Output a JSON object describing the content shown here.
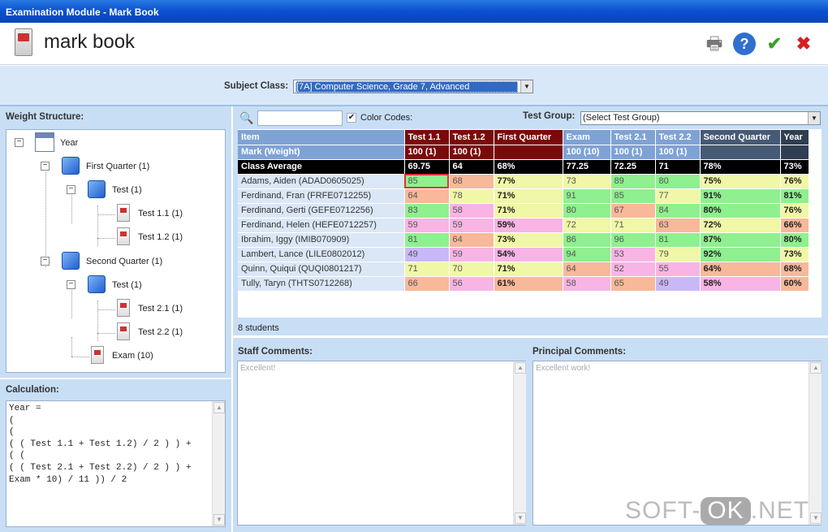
{
  "window": {
    "title": "Examination Module - Mark Book"
  },
  "header": {
    "title": "mark book"
  },
  "subject": {
    "label": "Subject Class:",
    "value": "[7A] Computer Science, Grade 7, Advanced"
  },
  "weight": {
    "heading": "Weight Structure:",
    "nodes": [
      "Year",
      "First Quarter (1)",
      "Test (1)",
      "Test 1.1 (1)",
      "Test 1.2 (1)",
      "Second Quarter (1)",
      "Test (1)",
      "Test 2.1 (1)",
      "Test 2.2 (1)",
      "Exam (10)"
    ]
  },
  "calculation": {
    "heading": "Calculation:",
    "text": "Year =\n(\n(\n( ( Test 1.1 + Test 1.2) / 2 ) ) +\n( (\n( ( Test 2.1 + Test 2.2) / 2 ) ) +\nExam * 10) / 11 )) / 2"
  },
  "toolbar": {
    "color_codes": "Color Codes:",
    "test_group_label": "Test Group:",
    "test_group_value": "(Select Test Group)"
  },
  "grid": {
    "headers": [
      "Item",
      "Test 1.1",
      "Test 1.2",
      "First Quarter",
      "Exam",
      "Test 2.1",
      "Test 2.2",
      "Second Quarter",
      "Year"
    ],
    "weights": [
      "Mark (Weight)",
      "100 (1)",
      "100 (1)",
      "",
      "100 (10)",
      "100 (1)",
      "100 (1)",
      "",
      ""
    ],
    "average": [
      "Class Average",
      "69.75",
      "64",
      "68%",
      "77.25",
      "72.25",
      "71",
      "78%",
      "73%"
    ],
    "rows": [
      [
        "Adams, Aiden (ADAD0605025)",
        "85",
        "68",
        "77%",
        "73",
        "89",
        "80",
        "75%",
        "76%"
      ],
      [
        "Ferdinand, Fran (FRFE0712255)",
        "64",
        "78",
        "71%",
        "91",
        "85",
        "77",
        "91%",
        "81%"
      ],
      [
        "Ferdinand, Gerti (GEFE0712256)",
        "83",
        "58",
        "71%",
        "80",
        "67",
        "84",
        "80%",
        "76%"
      ],
      [
        "Ferdinand, Helen (HEFE0712257)",
        "59",
        "59",
        "59%",
        "72",
        "71",
        "63",
        "72%",
        "66%"
      ],
      [
        "Ibrahim, Iggy (IMIB070909)",
        "81",
        "64",
        "73%",
        "86",
        "96",
        "81",
        "87%",
        "80%"
      ],
      [
        "Lambert, Lance (LILE0802012)",
        "49",
        "59",
        "54%",
        "94",
        "53",
        "79",
        "92%",
        "73%"
      ],
      [
        "Quinn, Quiqui (QUQI0801217)",
        "71",
        "70",
        "71%",
        "64",
        "52",
        "55",
        "64%",
        "68%"
      ],
      [
        "Tully, Taryn (THTS0712268)",
        "66",
        "56",
        "61%",
        "58",
        "65",
        "49",
        "58%",
        "60%"
      ]
    ],
    "count": "8 students"
  },
  "comments": {
    "staff_label": "Staff Comments:",
    "staff_text": "Excellent!",
    "principal_label": "Principal Comments:",
    "principal_text": "Excellent work!"
  },
  "watermark": {
    "a": "SOFT-",
    "b": "OK",
    ".c": ".NET",
    "c": ".NET"
  },
  "colors": {
    "green": "#8ef08e",
    "yellow": "#f0f7a6",
    "orange": "#f8b89a",
    "pink": "#f8b4e4",
    "purple": "#c9b8f8",
    "dark_red": "#7a0a0a",
    "blue_head": "#7fa2d6"
  }
}
